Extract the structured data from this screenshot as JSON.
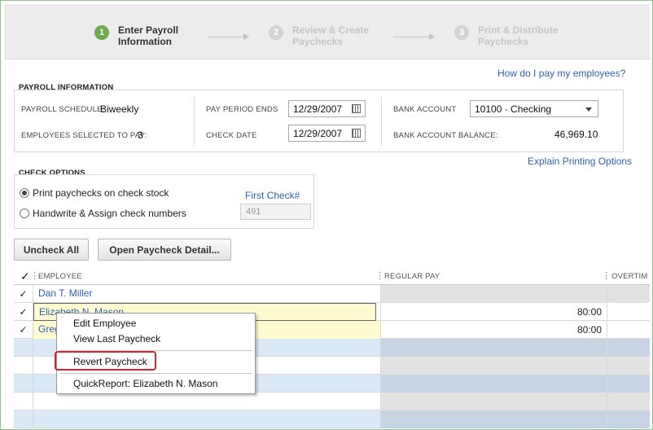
{
  "wizard": {
    "steps": [
      {
        "num": "1",
        "label": "Enter Payroll\nInformation"
      },
      {
        "num": "2",
        "label": "Review & Create\nPaychecks"
      },
      {
        "num": "3",
        "label": "Print & Distribute\nPaychecks"
      }
    ]
  },
  "help_link": "How do I pay my employees?",
  "payroll_info": {
    "title": "PAYROLL INFORMATION",
    "schedule_label": "PAYROLL SCHEDULE:",
    "schedule_value": "Biweekly",
    "employees_label": "EMPLOYEES SELECTED TO PAY:",
    "employees_value": "3",
    "period_ends_label": "PAY PERIOD ENDS",
    "period_ends_value": "12/29/2007",
    "check_date_label": "CHECK DATE",
    "check_date_value": "12/29/2007",
    "bank_account_label": "BANK ACCOUNT",
    "bank_account_value": "10100 · Checking",
    "bank_balance_label": "BANK ACCOUNT BALANCE:",
    "bank_balance_value": "46,969.10"
  },
  "explain_link": "Explain Printing Options",
  "check_options": {
    "title": "CHECK OPTIONS",
    "option1": "Print paychecks on check stock",
    "option2": "Handwrite & Assign check numbers",
    "first_check_label": "First Check#",
    "first_check_value": "491"
  },
  "buttons": {
    "uncheck_all": "Uncheck All",
    "open_detail": "Open Paycheck Detail..."
  },
  "grid": {
    "check_header": "✓",
    "col_employee": "EMPLOYEE",
    "col_regular": "REGULAR PAY",
    "col_overtime": "OVERTIM",
    "rows": [
      {
        "check": "✓",
        "employee": "Dan T. Miller",
        "regular": ""
      },
      {
        "check": "✓",
        "employee": "Elizabeth N. Mason",
        "regular": "80:00"
      },
      {
        "check": "✓",
        "employee": "Gregg O. Schneider",
        "regular": "80:00"
      }
    ]
  },
  "context_menu": {
    "edit_employee": "Edit Employee",
    "view_last": "View Last Paycheck",
    "revert": "Revert Paycheck",
    "quickreport": "QuickReport: Elizabeth N. Mason"
  }
}
